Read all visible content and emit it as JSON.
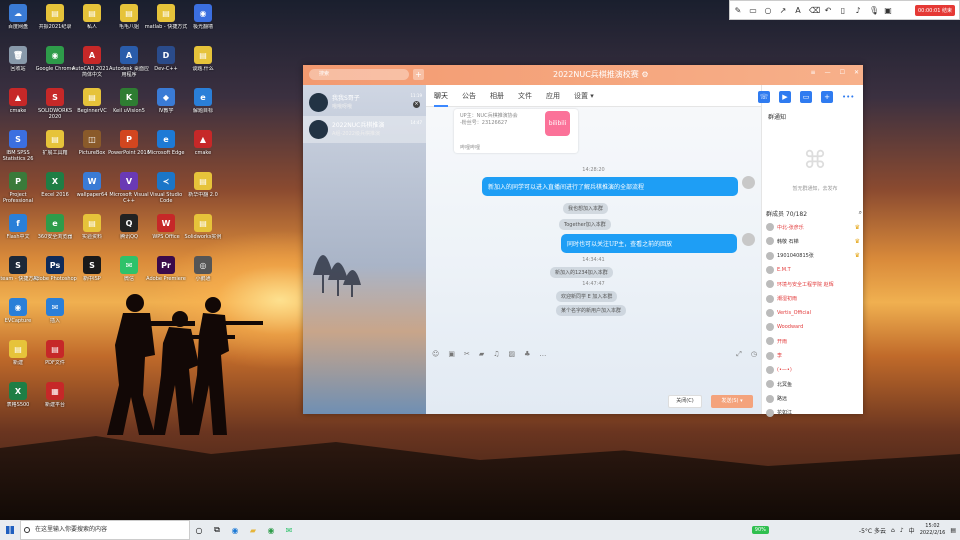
{
  "desktop": {
    "icons": [
      {
        "label": "百度网盘",
        "color": "#3a7bd5",
        "glyph": "☁"
      },
      {
        "label": "共振2021纪录",
        "color": "#e6c33a",
        "glyph": "▤"
      },
      {
        "label": "私人",
        "color": "#e6c33a",
        "glyph": "▤"
      },
      {
        "label": "毛毛八姐",
        "color": "#e6c33a",
        "glyph": "▤"
      },
      {
        "label": "matlab - 快捷方式",
        "color": "#e6c33a",
        "glyph": "▤"
      },
      {
        "label": "极光翻墙",
        "color": "#3b6fe0",
        "glyph": "◉"
      },
      {
        "label": "回收站",
        "color": "#8899aa",
        "glyph": "🗑"
      },
      {
        "label": "Google Chrome",
        "color": "#2e9c4a",
        "glyph": "◉"
      },
      {
        "label": "AutoCAD 2021 - 简体中文",
        "color": "#c62828",
        "glyph": "A"
      },
      {
        "label": "Autodesk 桌面应用程序",
        "color": "#2a5caa",
        "glyph": "A"
      },
      {
        "label": "Dev-C++",
        "color": "#2a4b8a",
        "glyph": "D"
      },
      {
        "label": "谈题.什么",
        "color": "#e6c33a",
        "glyph": "▤"
      },
      {
        "label": "cmake",
        "color": "#c62828",
        "glyph": "▲"
      },
      {
        "label": "SOLIDWORKS 2020",
        "color": "#c62828",
        "glyph": "S"
      },
      {
        "label": "BeginnerVC",
        "color": "#e6c33a",
        "glyph": "▤"
      },
      {
        "label": "Keil uVision5",
        "color": "#2e7d32",
        "glyph": "K"
      },
      {
        "label": "IV教学",
        "color": "#3a7bd5",
        "glyph": "◆"
      },
      {
        "label": "解题目标",
        "color": "#2a7fd8",
        "glyph": "e"
      },
      {
        "label": "IBM SPSS Statistics 26",
        "color": "#3b6fe0",
        "glyph": "S"
      },
      {
        "label": "扩展工具箱",
        "color": "#e6c33a",
        "glyph": "▤"
      },
      {
        "label": "PictureBox",
        "color": "#8a5a2a",
        "glyph": "◫"
      },
      {
        "label": "PowerPoint 2016",
        "color": "#d2461f",
        "glyph": "P"
      },
      {
        "label": "Microsoft Edge",
        "color": "#1d7ad6",
        "glyph": "e"
      },
      {
        "label": "cmake",
        "color": "#c62828",
        "glyph": "▲"
      },
      {
        "label": "Project Professional",
        "color": "#3a7a3a",
        "glyph": "P"
      },
      {
        "label": "Excel 2016",
        "color": "#1e7e45",
        "glyph": "X"
      },
      {
        "label": "wallpaper64",
        "color": "#3a7bd5",
        "glyph": "W"
      },
      {
        "label": "Microsoft Visual C++",
        "color": "#6a3ab5",
        "glyph": "V"
      },
      {
        "label": "Visual Studio Code",
        "color": "#1b76c8",
        "glyph": "≺"
      },
      {
        "label": "新华中翻 2.0",
        "color": "#e6c33a",
        "glyph": "▤"
      },
      {
        "label": "Flash中文",
        "color": "#2a7fd8",
        "glyph": "f"
      },
      {
        "label": "360安全浏览器",
        "color": "#2e9c4a",
        "glyph": "e"
      },
      {
        "label": "实验资料",
        "color": "#e6c33a",
        "glyph": "▤"
      },
      {
        "label": "腾讯QQ",
        "color": "#222",
        "glyph": "Q"
      },
      {
        "label": "WPS Office",
        "color": "#c62828",
        "glyph": "W"
      },
      {
        "label": "Solidworks实例",
        "color": "#e6c33a",
        "glyph": "▤"
      },
      {
        "label": "steam - 快捷方式",
        "color": "#1b2838",
        "glyph": "S"
      },
      {
        "label": "Adobe Photoshop",
        "color": "#0f2b5a",
        "glyph": "Ps"
      },
      {
        "label": "新中ISP",
        "color": "#1a1a1a",
        "glyph": "S"
      },
      {
        "label": "微信",
        "color": "#2ec26a",
        "glyph": "✉"
      },
      {
        "label": "Adobe Premiere",
        "color": "#3a0a4a",
        "glyph": "Pr"
      },
      {
        "label": "小鹅通",
        "color": "#555",
        "glyph": "◎"
      },
      {
        "label": "EVCapture",
        "color": "#2a7fd8",
        "glyph": "◉"
      },
      {
        "label": "插入",
        "color": "#2a7fd8",
        "glyph": "✉"
      },
      {
        "label": "新建",
        "color": "#e6c33a",
        "glyph": "▤"
      },
      {
        "label": "PDF文件",
        "color": "#c62828",
        "glyph": "▤"
      },
      {
        "label": "表格S500",
        "color": "#1e7e45",
        "glyph": "X"
      },
      {
        "label": "新建平台",
        "color": "#c62828",
        "glyph": "▦"
      }
    ]
  },
  "recorder": {
    "stop_label": "00:00:01 结束"
  },
  "chat": {
    "search_placeholder": "搜索",
    "window_title": "2022NUC兵棋推演校赛 ⚙",
    "conversations": [
      {
        "name": "我我S哥子",
        "sub": "哦哦呀哦",
        "time": "11:19"
      },
      {
        "name": "2022NUC兵棋推演",
        "sub": "A组-2022级兵棋推演",
        "time": "14:47"
      }
    ],
    "tabs": [
      "聊天",
      "公告",
      "相册",
      "文件",
      "应用",
      "设置 ▾"
    ],
    "card": {
      "line1": "UP主：NUC兵棋推演协会",
      "line2": "-粉丝号：23126627",
      "footer": "哔哩哔哩",
      "logo": "bilibili"
    },
    "messages": [
      {
        "kind": "time",
        "text": "14:28:20"
      },
      {
        "kind": "bubble",
        "text": "新加入的同学可以进入直播间进行了解兵棋推演的全部流程"
      },
      {
        "kind": "sys",
        "text": "我也想加入本群"
      },
      {
        "kind": "sys",
        "text": "Together加入本群"
      },
      {
        "kind": "bubble",
        "text": "同时也可以关注UP主，查看之前的回放"
      },
      {
        "kind": "time",
        "text": "14:34:41"
      },
      {
        "kind": "sys",
        "text": "新加入的1234加入本群"
      },
      {
        "kind": "time",
        "text": "14:47:47"
      },
      {
        "kind": "sys",
        "text": "欢迎新同学 E 加入本群"
      },
      {
        "kind": "sys",
        "text": "某个名字的新用户加入本群"
      }
    ],
    "close_label": "关闭(C)",
    "send_label": "发送(S) ▾"
  },
  "panel": {
    "notice_title": "群通知",
    "notice_empty": "暂无群通知，去发布",
    "members_title": "群成员 70/182",
    "members": [
      {
        "name": "中北-张彦乐",
        "red": true,
        "badge": "♛"
      },
      {
        "name": "韩敬 石梯",
        "red": false,
        "badge": "♛"
      },
      {
        "name": "1901040815张",
        "red": false,
        "badge": "♛"
      },
      {
        "name": "E.M.T",
        "red": true,
        "badge": ""
      },
      {
        "name": "环境与安全工程学院 赵辉",
        "red": true,
        "badge": ""
      },
      {
        "name": "潮湿初雨",
        "red": true,
        "badge": ""
      },
      {
        "name": "Vertis_Official",
        "red": true,
        "badge": ""
      },
      {
        "name": "Woodward",
        "red": true,
        "badge": ""
      },
      {
        "name": "开雨",
        "red": true,
        "badge": ""
      },
      {
        "name": "李",
        "red": true,
        "badge": ""
      },
      {
        "name": "(•—•)",
        "red": true,
        "badge": ""
      },
      {
        "name": "北冥鱼",
        "red": false,
        "badge": ""
      },
      {
        "name": "路远",
        "red": false,
        "badge": ""
      },
      {
        "name": "花如江",
        "red": false,
        "badge": ""
      }
    ]
  },
  "taskbar": {
    "search_placeholder": "在这里输入你要搜索的内容",
    "battery": "90%",
    "weather": "-5°C 多云",
    "ime": "中",
    "time": "15:02",
    "date": "2022/2/16"
  }
}
